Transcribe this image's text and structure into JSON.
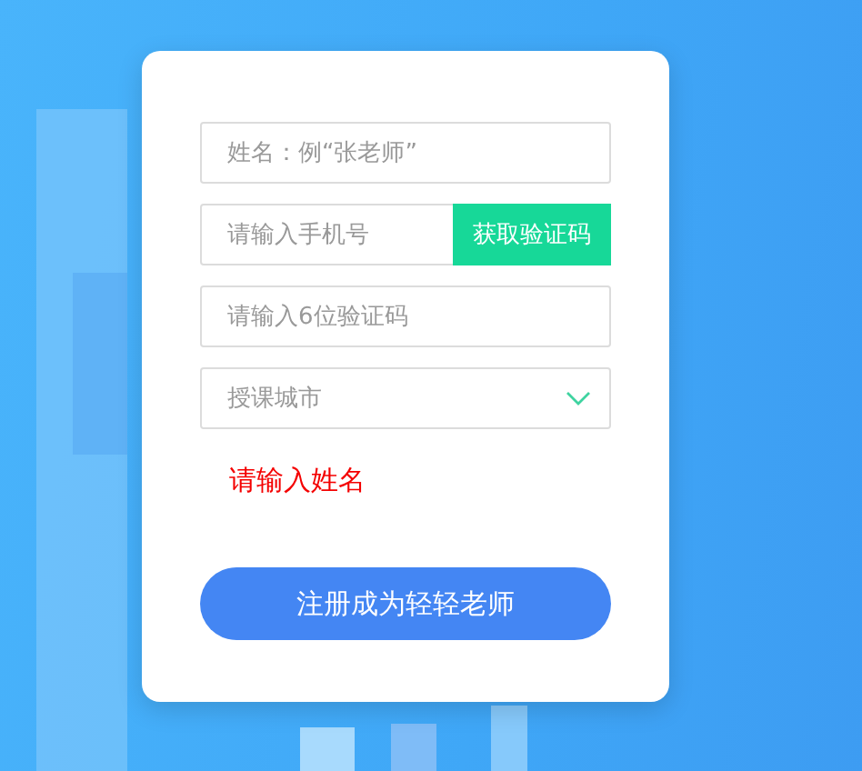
{
  "form": {
    "fields": [
      {
        "kind": "input",
        "placeholder": "姓名：例“张老师”"
      },
      {
        "kind": "input_with_button",
        "placeholder": "请输入手机号",
        "button": "获取验证码"
      },
      {
        "kind": "input",
        "placeholder": "请输入6位验证码"
      },
      {
        "kind": "select",
        "placeholder": "授课城市"
      }
    ],
    "error": "请输入姓名",
    "submit": "注册成为轻轻老师"
  }
}
